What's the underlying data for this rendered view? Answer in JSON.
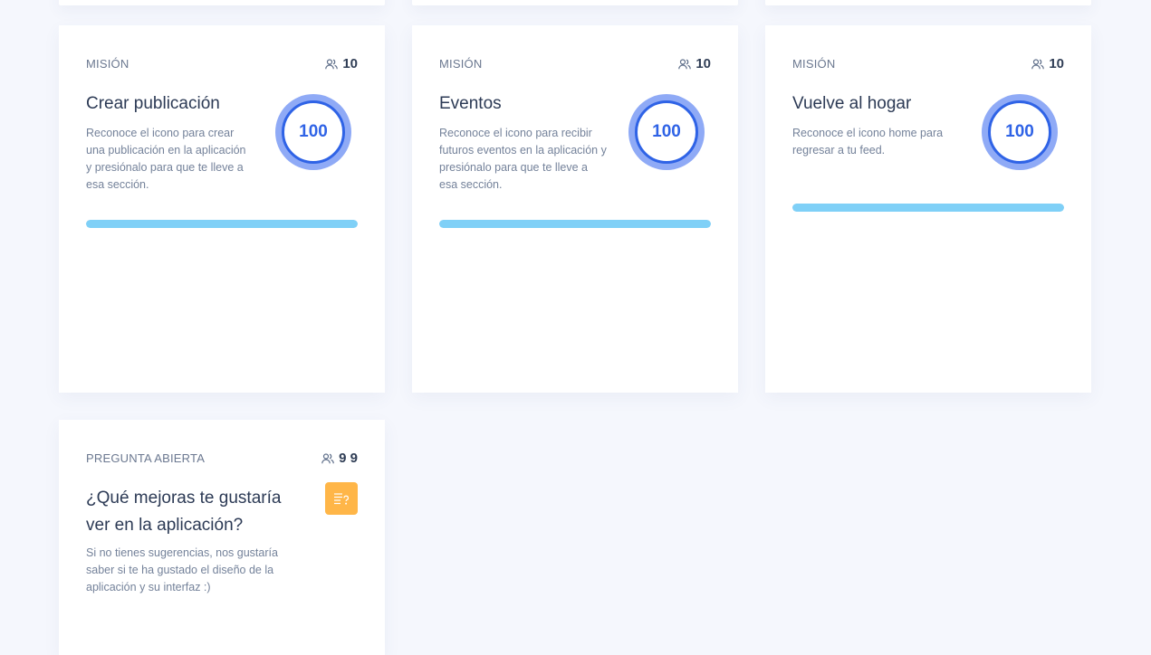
{
  "cards": [
    {
      "type": "MISIÓN",
      "participants": "10",
      "title": "Crear publicación",
      "description": "Reconoce el icono para crear una publicación en la aplicación y presiónalo para que te lleve a esa sección.",
      "score": "100",
      "progress": 1.0,
      "icon": "users-icon"
    },
    {
      "type": "MISIÓN",
      "participants": "10",
      "title": "Eventos",
      "description": "Reconoce el icono para recibir futuros eventos en la aplicación y presiónalo para que te lleve a esa sección.",
      "score": "100",
      "progress": 1.0,
      "icon": "users-icon"
    },
    {
      "type": "MISIÓN",
      "participants": "10",
      "title": "Vuelve al hogar",
      "description": "Reconoce el icono home para regresar a tu feed.",
      "score": "100",
      "progress": 1.0,
      "icon": "users-icon"
    },
    {
      "type": "PREGUNTA ABIERTA",
      "participants": "9 9",
      "title": "¿Qué mejoras te gustaría ver en la aplicación?",
      "description": "Si no tienes sugerencias, nos gustaría saber si te ha gustado el diseño de la aplicación y su interfaz :)",
      "icon": "open-question-icon"
    }
  ],
  "colors": {
    "background": "#f5f7fd",
    "score_ring": "#2f63e6",
    "score_halo": "#8faaf6",
    "progress": "#7fd0f7",
    "question_icon": "#ffb648",
    "title": "#2c3a55",
    "text_muted": "#74829a"
  }
}
